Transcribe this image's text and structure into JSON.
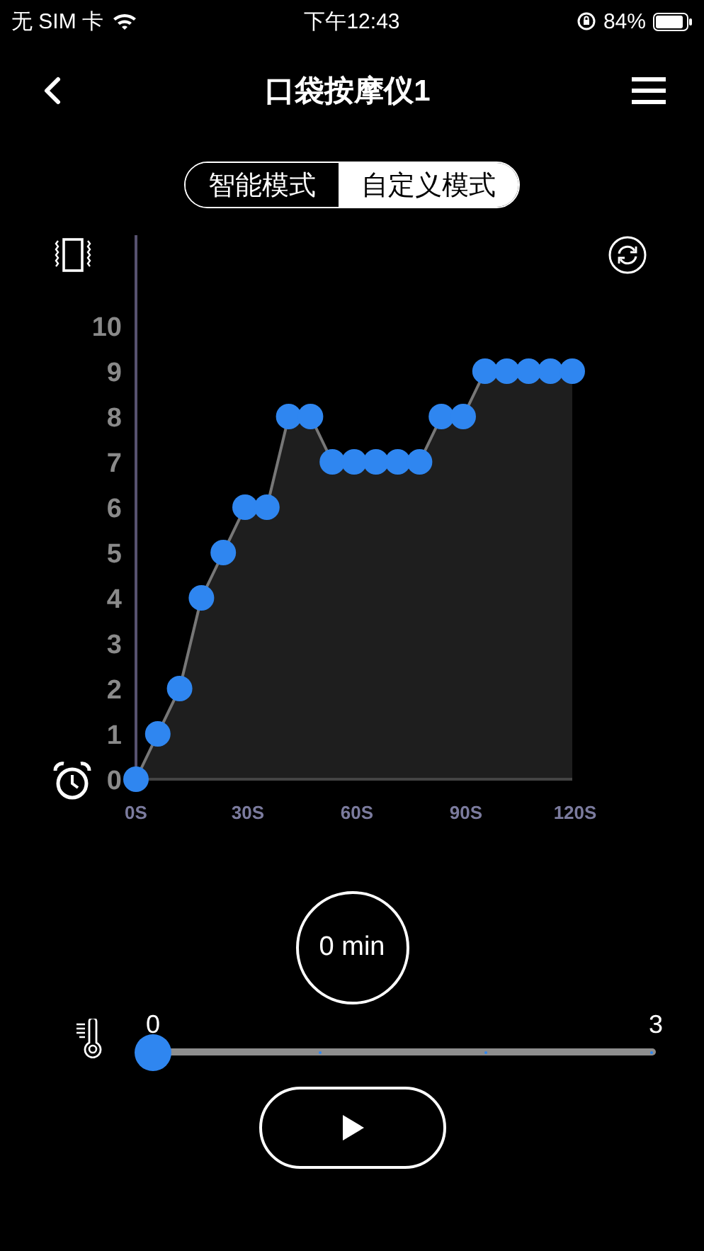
{
  "status_bar": {
    "carrier": "无 SIM 卡",
    "time": "下午12:43",
    "battery": "84%"
  },
  "header": {
    "title": "口袋按摩仪1"
  },
  "mode_tabs": [
    {
      "label": "智能模式",
      "selected": false
    },
    {
      "label": "自定义模式",
      "selected": true
    }
  ],
  "chart": {
    "chart_data": {
      "type": "area",
      "x": [
        0,
        6,
        12,
        18,
        24,
        30,
        36,
        42,
        48,
        54,
        60,
        66,
        72,
        78,
        84,
        90,
        96,
        102,
        108,
        114,
        120
      ],
      "series": [
        {
          "color": "#2f86f0",
          "values": [
            0,
            1,
            2,
            4,
            5,
            6,
            6,
            8,
            8,
            7,
            7,
            7,
            7,
            7,
            8,
            8,
            9,
            9,
            9,
            9,
            9
          ]
        }
      ],
      "xlim": [
        0,
        120
      ],
      "ylim": [
        0,
        12
      ],
      "xticks": [
        {
          "value": 0,
          "label": "0S"
        },
        {
          "value": 30,
          "label": "30S"
        },
        {
          "value": 60,
          "label": "60S"
        },
        {
          "value": 90,
          "label": "90S"
        },
        {
          "value": 120,
          "label": "120S"
        }
      ],
      "yticks": [
        0,
        1,
        2,
        3,
        4,
        5,
        6,
        7,
        8,
        9,
        10
      ]
    }
  },
  "timer": {
    "text": "0 min"
  },
  "slider": {
    "min_label": "0",
    "max_label": "3",
    "level": 0
  }
}
